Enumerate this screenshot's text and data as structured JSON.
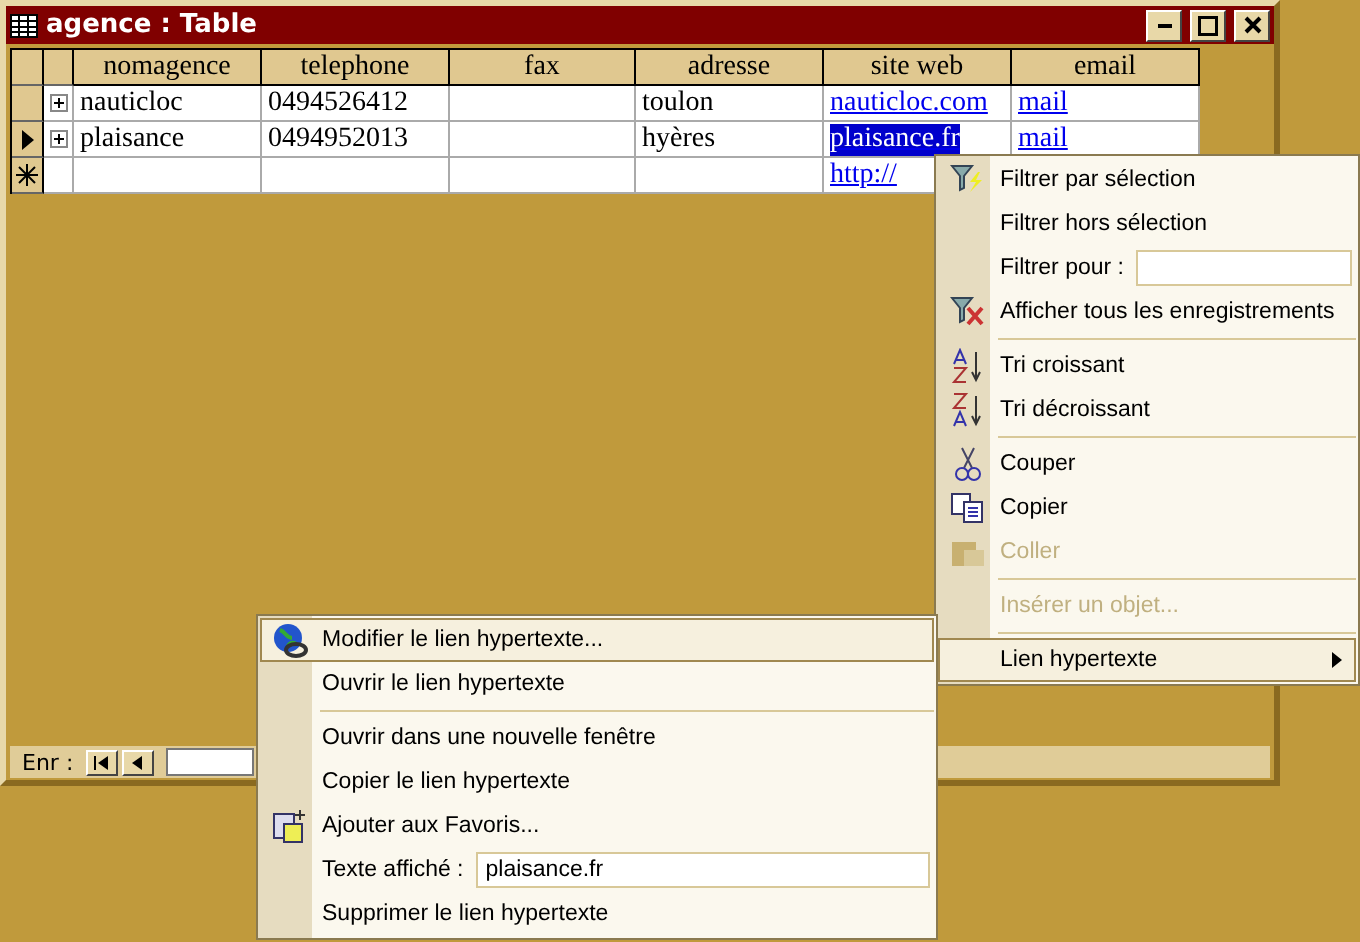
{
  "window": {
    "title": "agence : Table"
  },
  "table": {
    "columns": [
      {
        "label": "nomagence",
        "kind": "text"
      },
      {
        "label": "telephone",
        "kind": "text"
      },
      {
        "label": "fax",
        "kind": "text"
      },
      {
        "label": "adresse",
        "kind": "text"
      },
      {
        "label": "site web",
        "kind": "link"
      },
      {
        "label": "email",
        "kind": "link"
      }
    ],
    "rows": [
      {
        "kind": "record",
        "selected": false,
        "cells": [
          {
            "text": "nauticloc",
            "selected": false
          },
          {
            "text": "0494526412",
            "selected": false
          },
          null,
          {
            "text": "toulon",
            "selected": false
          },
          {
            "text": "nauticloc.com",
            "selected": false
          },
          {
            "text": "mail",
            "selected": false
          }
        ]
      },
      {
        "kind": "record",
        "selected": true,
        "cells": [
          {
            "text": "plaisance",
            "selected": false
          },
          {
            "text": "0494952013",
            "selected": false
          },
          null,
          {
            "text": "hyères",
            "selected": false
          },
          {
            "text": "plaisance.fr",
            "selected": true
          },
          {
            "text": "mail",
            "selected": false
          }
        ]
      },
      {
        "kind": "new",
        "selected": false,
        "cells": [
          null,
          null,
          null,
          null,
          {
            "text": "http://",
            "selected": false
          }
        ]
      }
    ]
  },
  "status_bar": {
    "label": "Enr :"
  },
  "context_menu": {
    "groups": [
      [
        {
          "kind": "command",
          "label": "Filtrer par sélection",
          "disabled": false,
          "selected": false
        },
        {
          "kind": "command",
          "label": "Filtrer hors sélection",
          "disabled": false,
          "selected": false
        },
        {
          "kind": "field",
          "label": "Filtrer pour :",
          "disabled": false,
          "selected": false
        },
        {
          "kind": "command",
          "label": "Afficher tous les enregistrements",
          "disabled": false,
          "selected": false
        }
      ],
      [
        {
          "kind": "command",
          "label": "Tri croissant",
          "disabled": false,
          "selected": false
        },
        {
          "kind": "command",
          "label": "Tri décroissant",
          "disabled": false,
          "selected": false
        }
      ],
      [
        {
          "kind": "command",
          "label": "Couper",
          "disabled": false,
          "selected": false
        },
        {
          "kind": "command",
          "label": "Copier",
          "disabled": false,
          "selected": false
        },
        {
          "kind": "command",
          "label": "Coller",
          "disabled": true,
          "selected": false
        }
      ],
      [
        {
          "kind": "command",
          "label": "Insérer un objet...",
          "disabled": true,
          "selected": false
        }
      ],
      [
        {
          "kind": "submenu",
          "label": "Lien hypertexte",
          "disabled": false,
          "selected": true
        }
      ]
    ]
  },
  "submenu": {
    "groups": [
      [
        {
          "kind": "command",
          "label": "Modifier le lien hypertexte...",
          "disabled": false,
          "selected": true
        },
        {
          "kind": "command",
          "label": "Ouvrir le lien hypertexte",
          "disabled": false,
          "selected": false
        }
      ],
      [
        {
          "kind": "command",
          "label": "Ouvrir dans une nouvelle fenêtre",
          "disabled": false,
          "selected": false
        },
        {
          "kind": "command",
          "label": "Copier le lien hypertexte",
          "disabled": false,
          "selected": false
        },
        {
          "kind": "command",
          "label": "Ajouter aux Favoris...",
          "disabled": false,
          "selected": false
        },
        {
          "kind": "field",
          "label": "Texte affiché :",
          "value": "plaisance.fr",
          "disabled": false,
          "selected": false
        },
        {
          "kind": "command",
          "label": "Supprimer le lien hypertexte",
          "disabled": false,
          "selected": false
        }
      ]
    ]
  }
}
